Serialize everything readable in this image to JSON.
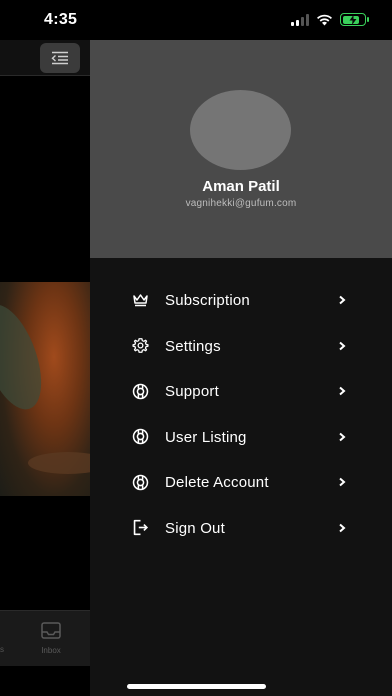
{
  "status_bar": {
    "time": "4:35",
    "battery_color": "#3ad15b"
  },
  "background": {
    "tab_inbox_label": "Inbox",
    "tab_partial_label": "s"
  },
  "profile": {
    "name": "Aman Patil",
    "email": "vagnihekki@gufum.com"
  },
  "menu": {
    "items": [
      {
        "label": "Subscription",
        "icon": "crown-icon"
      },
      {
        "label": "Settings",
        "icon": "gear-icon"
      },
      {
        "label": "Support",
        "icon": "lifebuoy-icon"
      },
      {
        "label": "User Listing",
        "icon": "lifebuoy-icon"
      },
      {
        "label": "Delete Account",
        "icon": "lifebuoy-icon"
      },
      {
        "label": "Sign Out",
        "icon": "sign-out-icon"
      }
    ]
  },
  "colors": {
    "drawer_bg": "#121212",
    "profile_bg": "#4a4a4a",
    "avatar_bg": "#757575"
  }
}
